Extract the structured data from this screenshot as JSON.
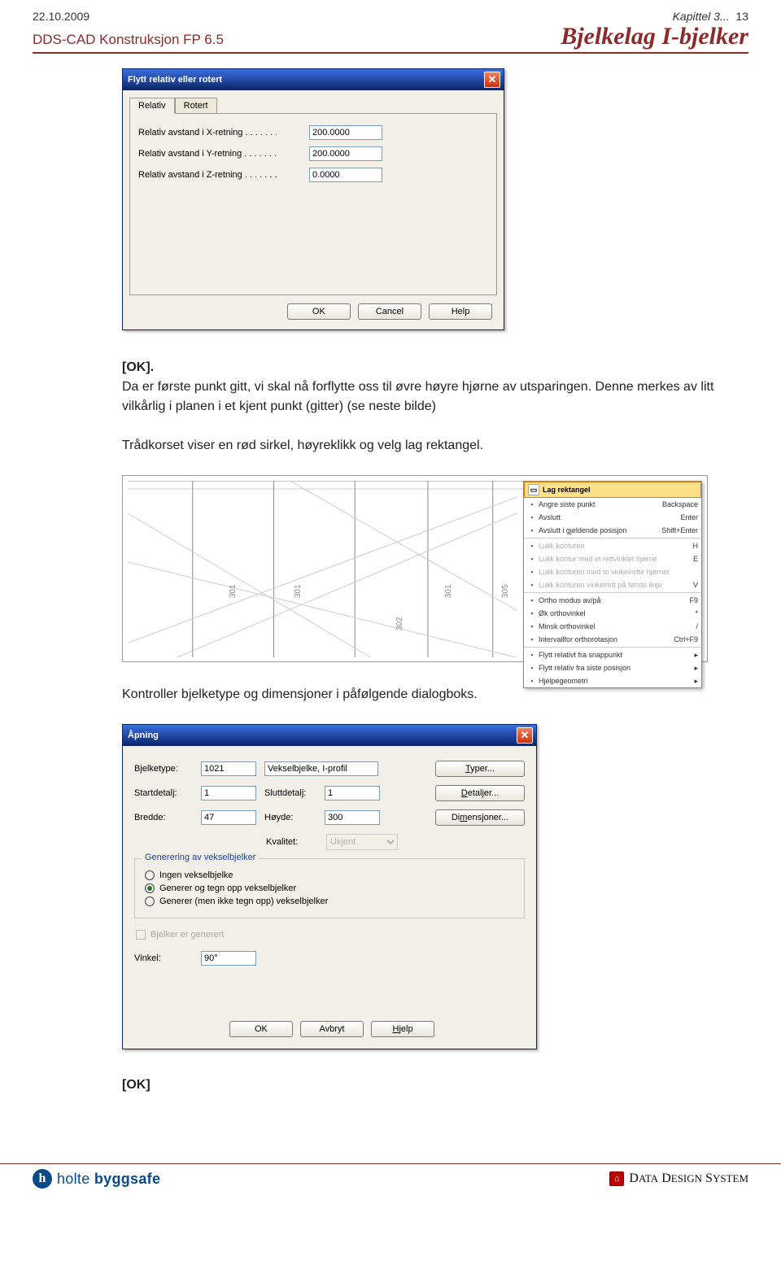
{
  "header": {
    "date": "22.10.2009",
    "chapter": "Kapittel 3...",
    "pageno": "13",
    "product": "DDS-CAD Konstruksjon  FP  6.5",
    "title": "Bjelkelag I-bjelker"
  },
  "dialog1": {
    "title": "Flytt relativ eller rotert",
    "tab_relativ": "Relativ",
    "tab_rotert": "Rotert",
    "row_x_label": "Relativ avstand i X-retning . . . . . . .",
    "row_x_value": "200.0000",
    "row_y_label": "Relativ avstand i Y-retning . . . . . . .",
    "row_y_value": "200.0000",
    "row_z_label": "Relativ avstand i Z-retning . . . . . . .",
    "row_z_value": "0.0000",
    "btn_ok": "OK",
    "btn_cancel": "Cancel",
    "btn_help": "Help"
  },
  "para1_bold": "[OK].",
  "para1": "Da er første punkt gitt, vi skal nå forflytte oss til øvre høyre hjørne av utsparingen. Denne merkes av litt vilkårlig i planen i et kjent punkt (gitter) (se neste bilde)",
  "para2": "Trådkorset viser en rød sirkel, høyreklikk og velg lag rektangel.",
  "cad_labels": {
    "l1": "301",
    "l2": "301",
    "l3": "302",
    "l4": "301",
    "l5": "305"
  },
  "contextmenu": {
    "head": "Lag rektangel",
    "items": [
      {
        "t": "Angre siste punkt",
        "sc": "Backspace",
        "dis": false
      },
      {
        "t": "Avslutt",
        "sc": "Enter",
        "dis": false
      },
      {
        "t": "Avslutt i gjeldende posisjon",
        "sc": "Shift+Enter",
        "dis": false
      },
      {
        "sep": true
      },
      {
        "t": "Lukk konturen",
        "sc": "H",
        "dis": true
      },
      {
        "t": "Lukk kontur med et rettvinklet hjørne",
        "sc": "E",
        "dis": true
      },
      {
        "t": "Lukk konturen med to vinkelrette hjørner",
        "sc": "",
        "dis": true
      },
      {
        "t": "Lukk konturen vinkelrett på første linje",
        "sc": "V",
        "dis": true
      },
      {
        "sep": true
      },
      {
        "t": "Ortho modus av/på",
        "sc": "F9",
        "dis": false
      },
      {
        "t": "Øk orthovinkel",
        "sc": "*",
        "dis": false
      },
      {
        "t": "Minsk orthovinkel",
        "sc": "/",
        "dis": false
      },
      {
        "t": "Intervallfor orthorotasjon",
        "sc": "Ctrl+F9",
        "dis": false
      },
      {
        "sep": true
      },
      {
        "t": "Flytt relativt fra snappunkt",
        "sc": "",
        "dis": false,
        "sub": true
      },
      {
        "t": "Flytt relativ fra siste posisjon",
        "sc": "",
        "dis": false,
        "sub": true
      },
      {
        "t": "Hjelpegeometri",
        "sc": "",
        "dis": false,
        "sub": true
      }
    ]
  },
  "para3": "Kontroller bjelketype og dimensjoner i påfølgende dialogboks.",
  "dialog2": {
    "title": "Åpning",
    "bjelketype_lab": "Bjelketype:",
    "bjelketype_val": "1021",
    "bjelketype_desc": "Vekselbjelke, I-profil",
    "btn_typer": "Typer...",
    "start_lab": "Startdetalj:",
    "start_val": "1",
    "slutt_lab": "Sluttdetalj:",
    "slutt_val": "1",
    "btn_detaljer": "Detaljer...",
    "bredde_lab": "Bredde:",
    "bredde_val": "47",
    "hoyde_lab": "Høyde:",
    "hoyde_val": "300",
    "btn_dim": "Dimensjoner...",
    "kvalitet_lab": "Kvalitet:",
    "kvalitet_val": "Ukjent",
    "fieldset_legend": "Generering av vekselbjelker",
    "radio1": "Ingen vekselbjelke",
    "radio2": "Generer og tegn opp vekselbjelker",
    "radio3": "Generer (men ikke tegn opp) vekselbjelker",
    "chk": "Bjelker er generert",
    "vinkel_lab": "Vinkel:",
    "vinkel_val": "90°",
    "btn_ok": "OK",
    "btn_avbryt": "Avbryt",
    "btn_hjelp": "Hjelp"
  },
  "para4_bold": "[OK]",
  "footer": {
    "holte": "holte",
    "byggsafe": "byggsafe",
    "dds": "DATA DESIGN SYSTEM"
  }
}
